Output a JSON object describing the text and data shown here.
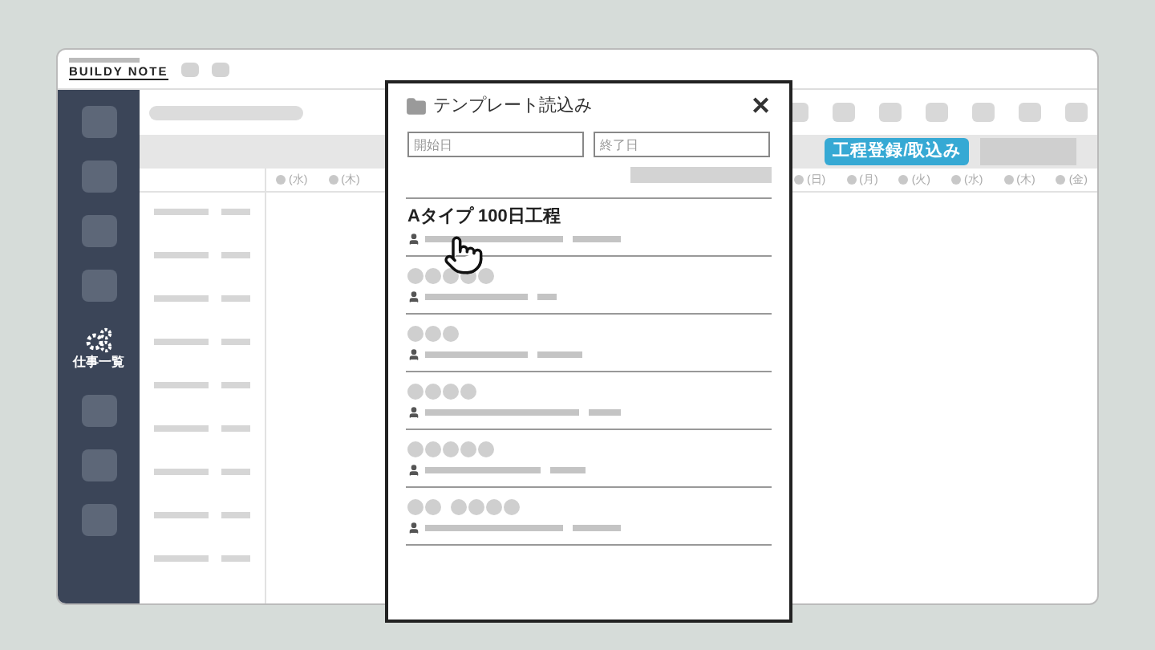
{
  "app": {
    "logo": "BUILDY NOTE"
  },
  "sidebar": {
    "items": [
      {
        "kind": "blank"
      },
      {
        "kind": "blank"
      },
      {
        "kind": "blank"
      },
      {
        "kind": "blank"
      },
      {
        "kind": "menu",
        "label": "仕事一覧"
      },
      {
        "kind": "blank"
      },
      {
        "kind": "blank"
      },
      {
        "kind": "blank"
      }
    ]
  },
  "toolbar": {
    "button": "工程登録/取込み"
  },
  "day_header": {
    "left": [
      "(水)",
      "(木)"
    ],
    "right": [
      "(日)",
      "(月)",
      "(火)",
      "(水)",
      "(木)",
      "(金)"
    ]
  },
  "dialog": {
    "title": "テンプレート読込み",
    "close": "✕",
    "fields": [
      {
        "placeholder": "開始日"
      },
      {
        "placeholder": "終了日"
      }
    ],
    "templates": [
      {
        "kind": "named",
        "name": "Aタイプ 100日工程"
      },
      {
        "kind": "blurred"
      },
      {
        "kind": "blurred"
      },
      {
        "kind": "blurred"
      },
      {
        "kind": "blurred"
      },
      {
        "kind": "blurred"
      }
    ]
  }
}
